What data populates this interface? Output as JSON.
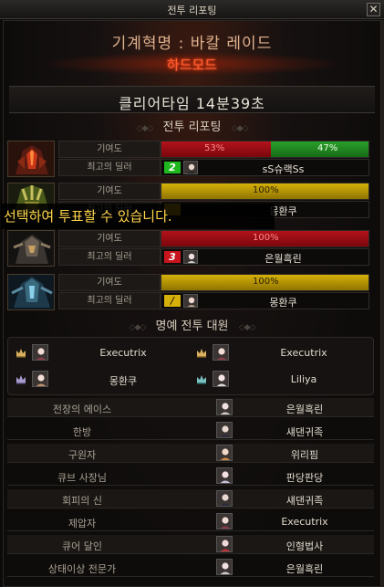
{
  "window": {
    "title": "전투 리포팅",
    "close_label": "✕"
  },
  "header": {
    "raid_title": "기계혁명 : 바칼 레이드",
    "difficulty": "하드모드",
    "clear_time": "클리어타임  14분39초"
  },
  "sections": {
    "battle_report": "전투 리포팅",
    "honor": "명예 전투 대원"
  },
  "labels": {
    "contribution": "기여도",
    "top_dealer": "최고의 딜러"
  },
  "toast": "선택하여 투표할 수 있습니다.",
  "bosses": [
    {
      "portrait_icon": "red-mech-boss-icon",
      "contribution_shares": [
        "53%",
        "47%"
      ],
      "contribution_red": 53,
      "contribution_green": 47,
      "dealer_rank": "2",
      "dealer_rank_color": "#1fb81f",
      "dealer_name": "sS슈랙Ss"
    },
    {
      "portrait_icon": "gold-mech-boss-icon",
      "contribution_shares": [
        "100%"
      ],
      "contribution_gold": 100,
      "dealer_rank": "",
      "dealer_rank_color": "#c9a400",
      "dealer_name": "몽환쿠"
    },
    {
      "portrait_icon": "black-mech-boss-icon",
      "contribution_shares": [
        "100%"
      ],
      "contribution_red": 100,
      "dealer_rank": "3",
      "dealer_rank_color": "#c8141e",
      "dealer_name": "은월흑린"
    },
    {
      "portrait_icon": "blue-mech-boss-icon",
      "contribution_shares": [
        "100%"
      ],
      "contribution_gold": 100,
      "dealer_rank": "/",
      "dealer_rank_color": "#d6b10a",
      "dealer_name": "몽환쿠"
    }
  ],
  "honor_members": [
    {
      "crown_icon": "crown-icon",
      "name": "Executrix"
    },
    {
      "crown_icon": "crown-icon",
      "name": "Executrix"
    },
    {
      "crown_icon": "crown-icon",
      "name": "몽환쿠"
    },
    {
      "crown_icon": "crown-icon",
      "name": "Liliya"
    }
  ],
  "awards": [
    {
      "title": "전장의 에이스",
      "name": "은월흑린"
    },
    {
      "title": "한방",
      "name": "섀댄귀족"
    },
    {
      "title": "구원자",
      "name": "위리핌"
    },
    {
      "title": "큐브 사장님",
      "name": "판당판당"
    },
    {
      "title": "회피의 신",
      "name": "섀댄귀족"
    },
    {
      "title": "제압자",
      "name": "Executrix"
    },
    {
      "title": "큐어 달인",
      "name": "인형법사"
    },
    {
      "title": "상태이상 전문가",
      "name": "은월흑린"
    }
  ],
  "colors": {
    "accent_red": "#ff5a2e",
    "gold_bar": "#d6b10a",
    "green_bar": "#2aa02a",
    "red_bar": "#b3121b"
  }
}
